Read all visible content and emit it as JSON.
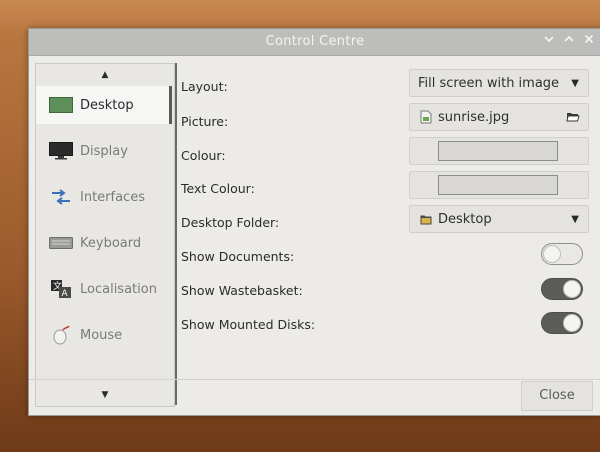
{
  "window": {
    "title": "Control Centre",
    "controls": [
      "minimize",
      "maximize",
      "close"
    ]
  },
  "sidebar": {
    "items": [
      {
        "label": "Desktop",
        "icon": "desktop-icon",
        "active": true
      },
      {
        "label": "Display",
        "icon": "monitor-icon",
        "active": false
      },
      {
        "label": "Interfaces",
        "icon": "interfaces-icon",
        "active": false
      },
      {
        "label": "Keyboard",
        "icon": "keyboard-icon",
        "active": false
      },
      {
        "label": "Localisation",
        "icon": "localisation-icon",
        "active": false
      },
      {
        "label": "Mouse",
        "icon": "mouse-icon",
        "active": false
      }
    ]
  },
  "settings": {
    "layout": {
      "label": "Layout:",
      "value": "Fill screen with image"
    },
    "picture": {
      "label": "Picture:",
      "value": "sunrise.jpg"
    },
    "colour": {
      "label": "Colour:",
      "value": "#d9d8d5"
    },
    "text_colour": {
      "label": "Text Colour:",
      "value": "#d9d8d5"
    },
    "desktop_folder": {
      "label": "Desktop Folder:",
      "value": "Desktop"
    },
    "show_documents": {
      "label": "Show Documents:",
      "enabled": false
    },
    "show_wastebasket": {
      "label": "Show Wastebasket:",
      "enabled": true
    },
    "show_mounted_disks": {
      "label": "Show Mounted Disks:",
      "enabled": true
    }
  },
  "footer": {
    "close_label": "Close"
  }
}
